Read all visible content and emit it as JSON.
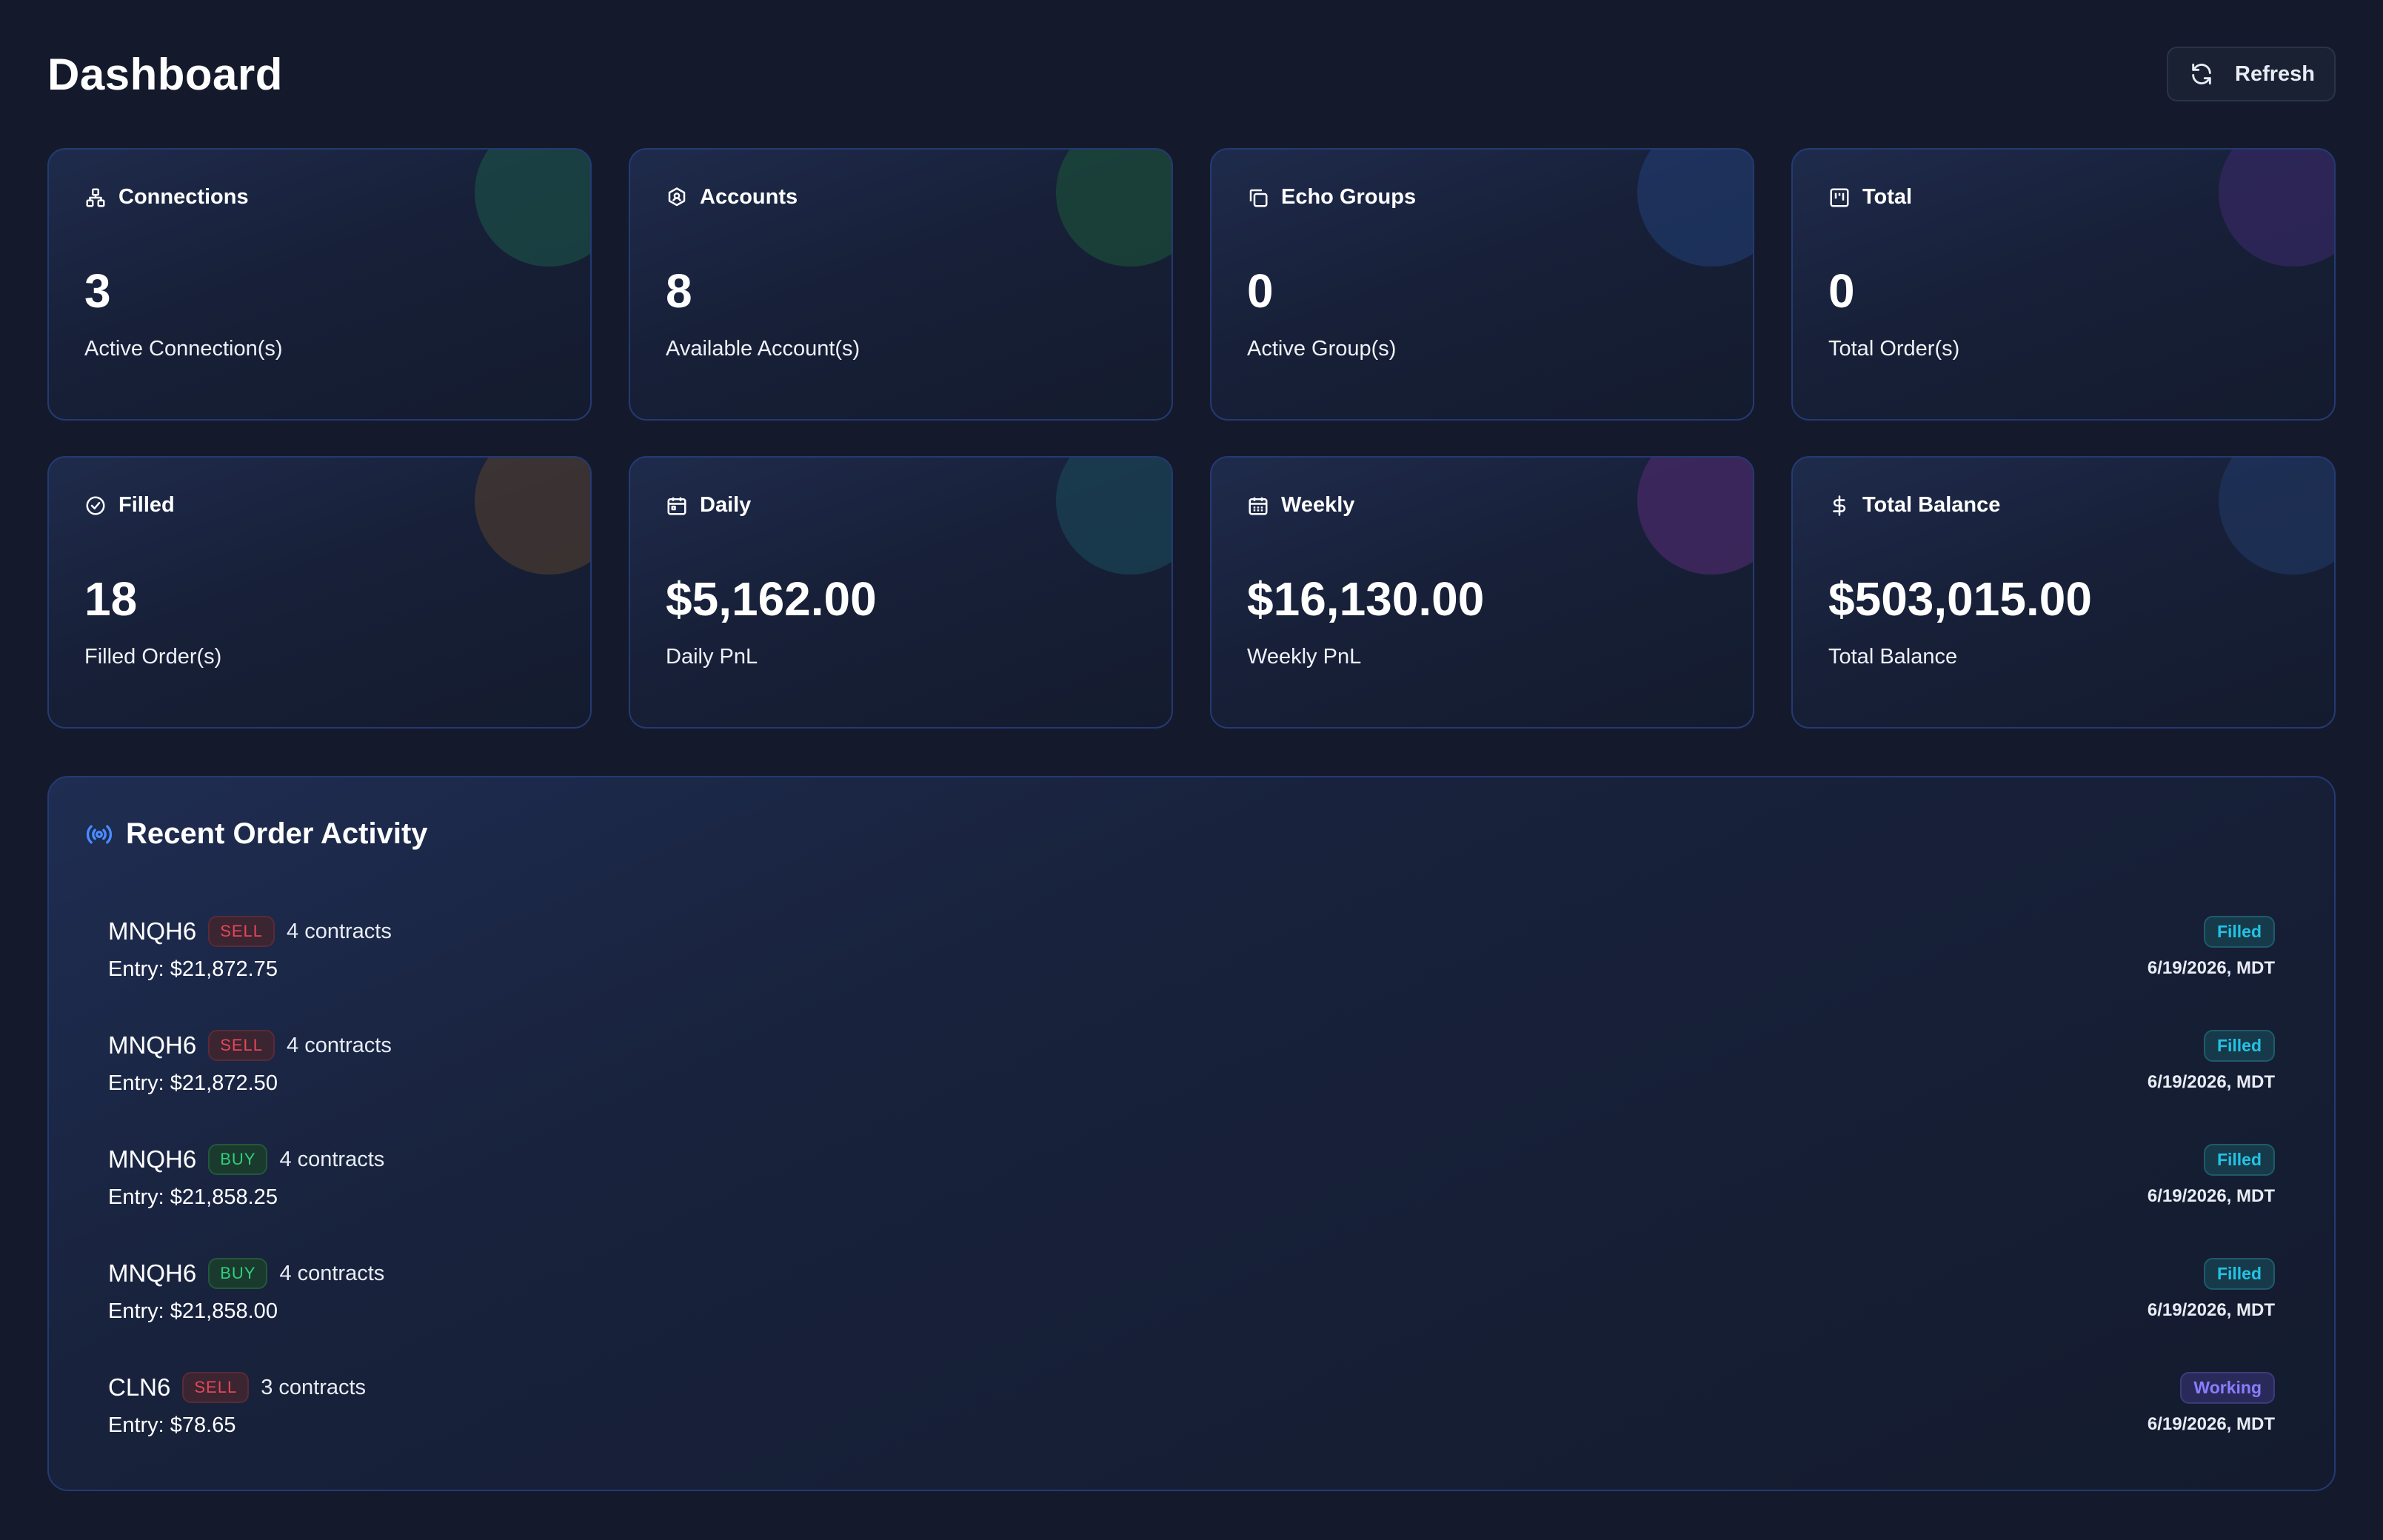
{
  "header": {
    "title": "Dashboard",
    "refresh_label": "Refresh"
  },
  "stats": [
    {
      "label": "Connections",
      "value": "3",
      "sub": "Active Connection(s)",
      "icon": "connections-icon",
      "accent": "#1e5a4a"
    },
    {
      "label": "Accounts",
      "value": "8",
      "sub": "Available Account(s)",
      "icon": "shield-icon",
      "accent": "#1e5a3a"
    },
    {
      "label": "Echo Groups",
      "value": "0",
      "sub": "Active Group(s)",
      "icon": "copy-icon",
      "accent": "#233f78"
    },
    {
      "label": "Total",
      "value": "0",
      "sub": "Total Order(s)",
      "icon": "kanban-icon",
      "accent": "#3a2a6a"
    },
    {
      "label": "Filled",
      "value": "18",
      "sub": "Filled Order(s)",
      "icon": "check-circle-icon",
      "accent": "#4a3a30"
    },
    {
      "label": "Daily",
      "value": "$5,162.00",
      "sub": "Daily PnL",
      "icon": "calendar-icon",
      "accent": "#1a4a5a"
    },
    {
      "label": "Weekly",
      "value": "$16,130.00",
      "sub": "Weekly PnL",
      "icon": "calendar-grid-icon",
      "accent": "#4a2a6a"
    },
    {
      "label": "Total Balance",
      "value": "$503,015.00",
      "sub": "Total Balance",
      "icon": "dollar-icon",
      "accent": "#233a6a"
    }
  ],
  "activity": {
    "title": "Recent Order Activity",
    "orders": [
      {
        "symbol": "MNQH6",
        "side": "SELL",
        "contracts": "4 contracts",
        "entry": "Entry: $21,872.75",
        "status": "Filled",
        "time": "6/19/2026, MDT"
      },
      {
        "symbol": "MNQH6",
        "side": "SELL",
        "contracts": "4 contracts",
        "entry": "Entry: $21,872.50",
        "status": "Filled",
        "time": "6/19/2026, MDT"
      },
      {
        "symbol": "MNQH6",
        "side": "BUY",
        "contracts": "4 contracts",
        "entry": "Entry: $21,858.25",
        "status": "Filled",
        "time": "6/19/2026, MDT"
      },
      {
        "symbol": "MNQH6",
        "side": "BUY",
        "contracts": "4 contracts",
        "entry": "Entry: $21,858.00",
        "status": "Filled",
        "time": "6/19/2026, MDT"
      },
      {
        "symbol": "CLN6",
        "side": "SELL",
        "contracts": "3 contracts",
        "entry": "Entry: $78.65",
        "status": "Working",
        "time": "6/19/2026, MDT"
      }
    ]
  },
  "colors": {
    "background": "#141a2c",
    "card_border": "#243a73",
    "sell": "#e8455a",
    "buy": "#2fcf7a",
    "filled": "#22c3e6",
    "working": "#8a7dff",
    "activity_icon": "#4a8cff"
  }
}
